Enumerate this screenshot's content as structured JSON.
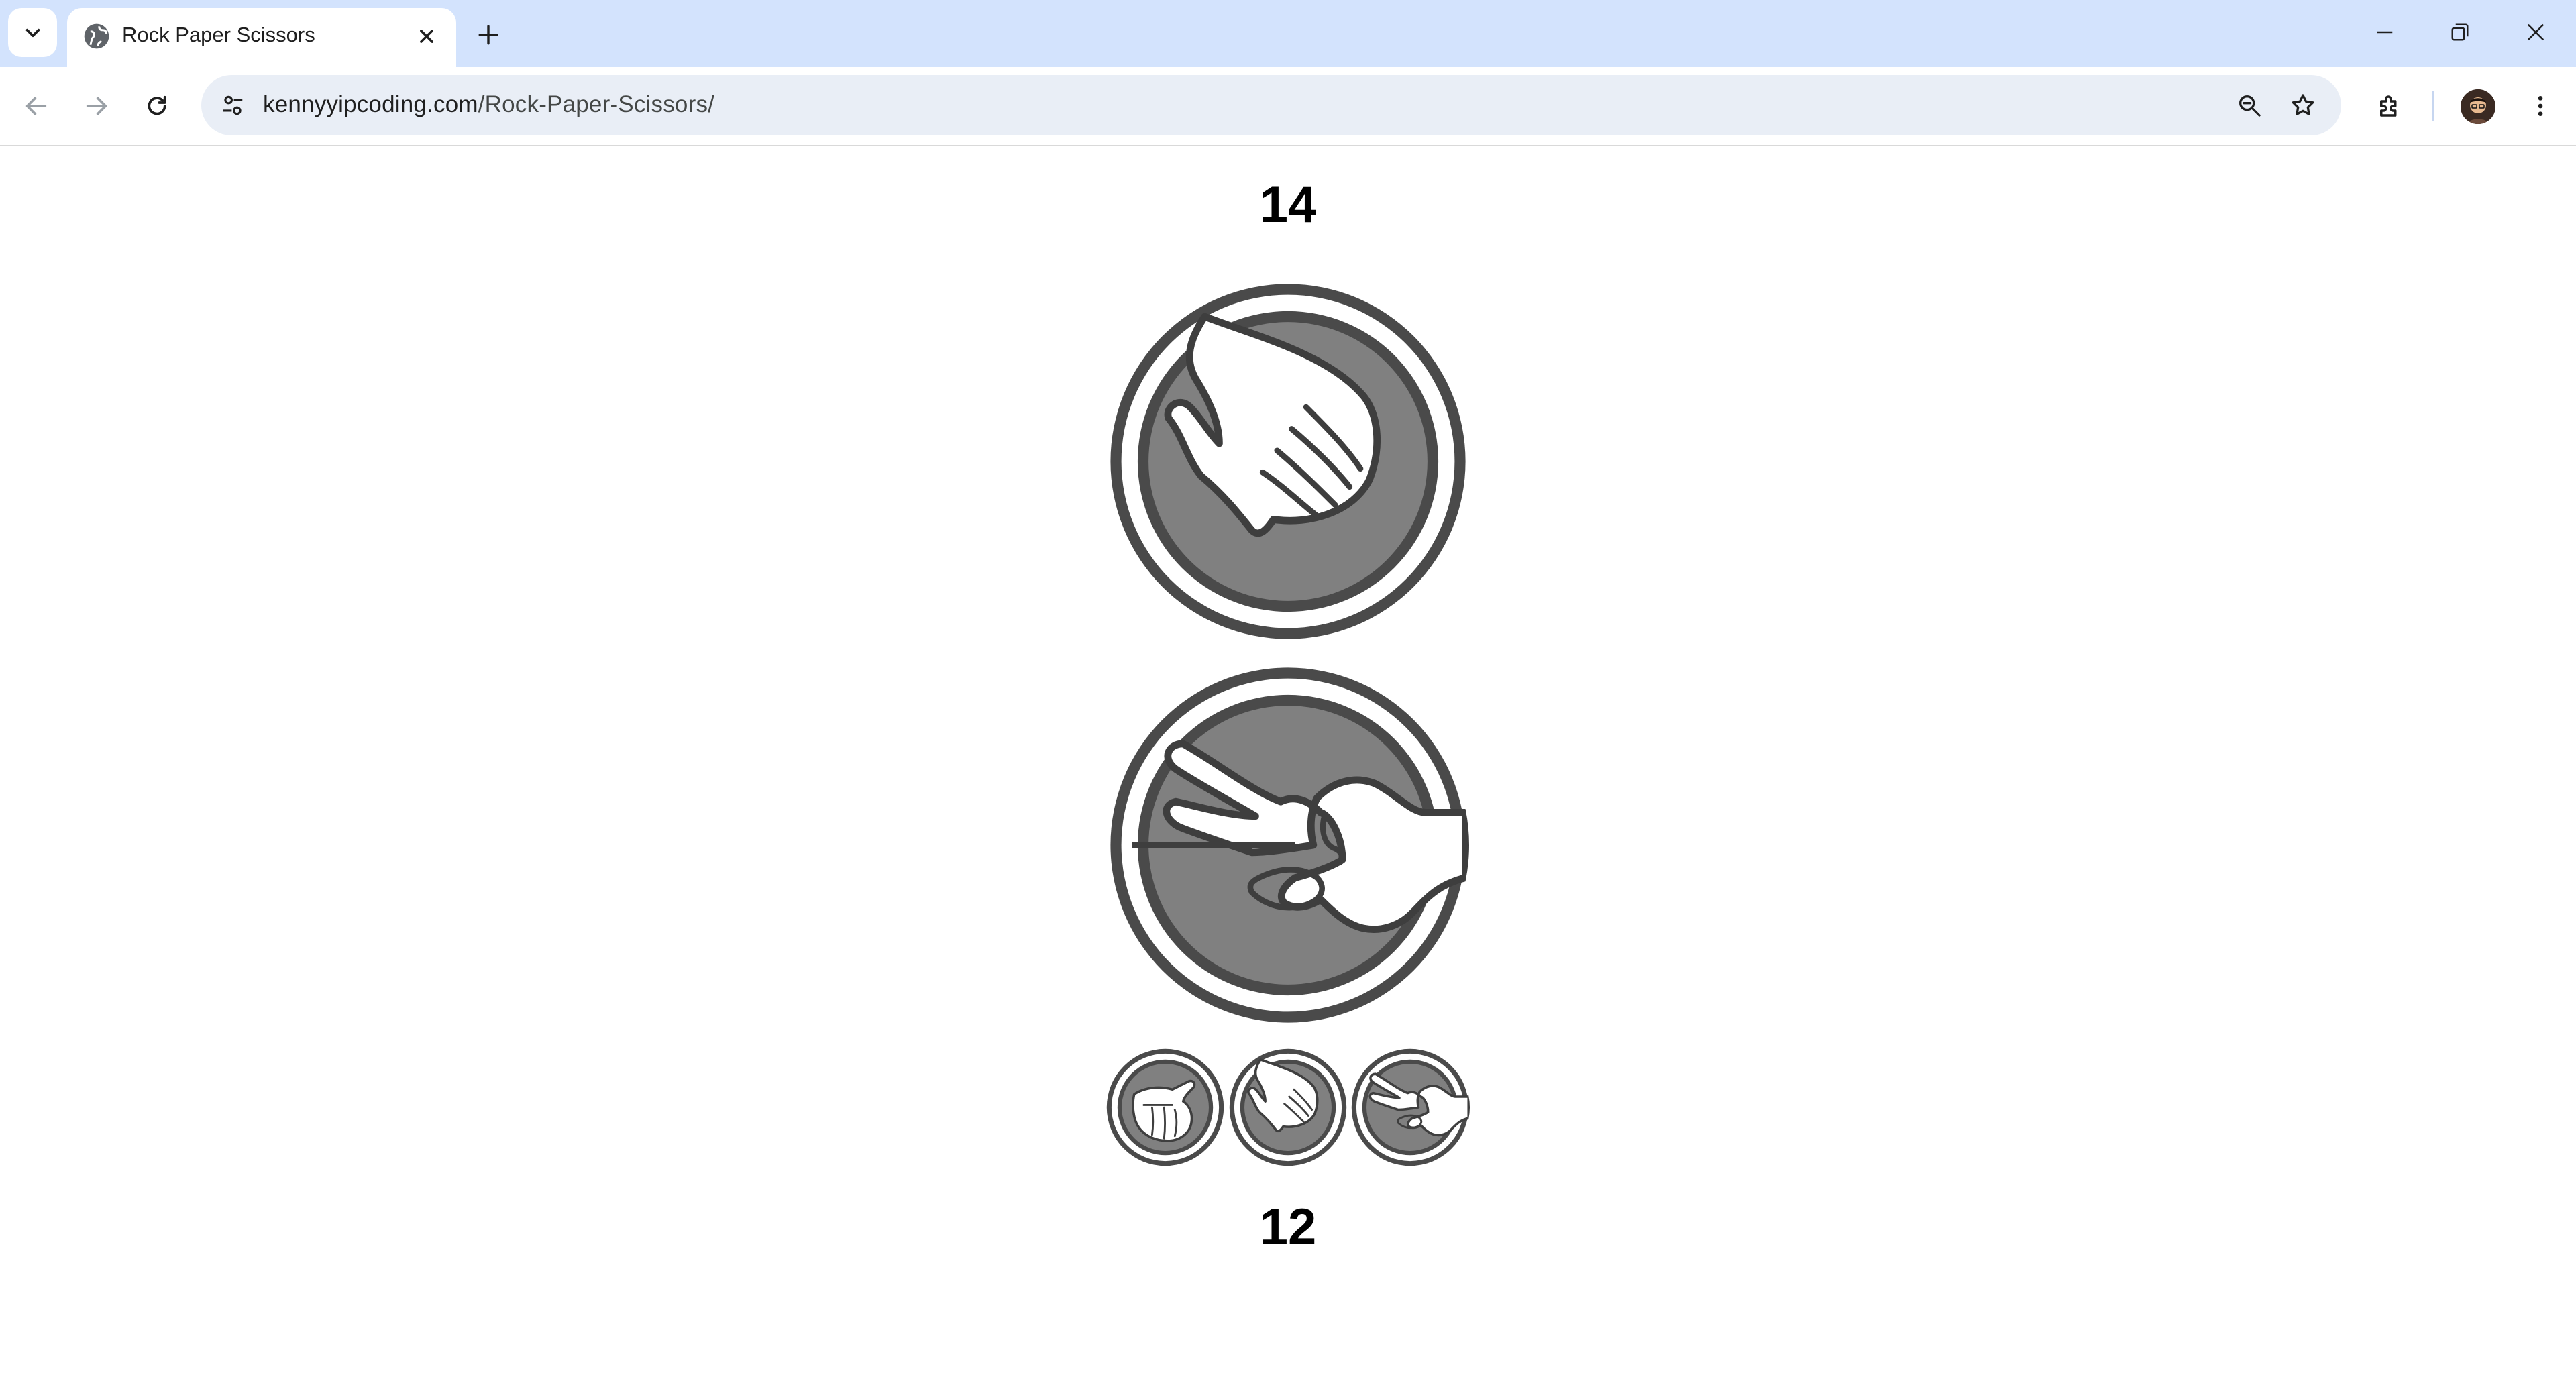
{
  "browser": {
    "tab_title": "Rock Paper Scissors",
    "url_host": "kennyyipcoding.com",
    "url_path": "/Rock-Paper-Scissors/"
  },
  "game": {
    "opponent_score": "14",
    "player_score": "12",
    "opponent_choice": "paper",
    "player_choice": "scissors",
    "choices": [
      "rock",
      "paper",
      "scissors"
    ]
  },
  "colors": {
    "tabstrip": "#d3e3fd",
    "icon_gray": "#808080",
    "icon_dark": "#4a4a4a"
  }
}
